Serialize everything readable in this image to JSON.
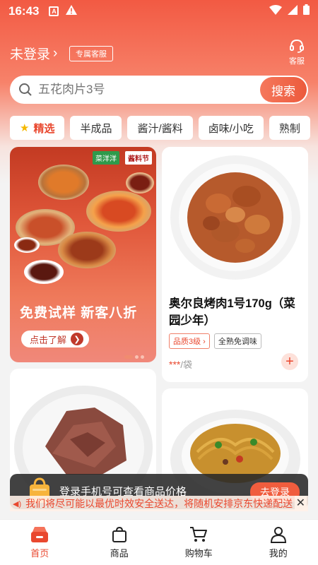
{
  "status_bar": {
    "time": "16:43",
    "notif_letter": "A"
  },
  "header": {
    "login_label": "未登录",
    "chevron": "›",
    "service_tag": "专属客服",
    "kefu_label": "客服"
  },
  "search": {
    "placeholder": "五花肉片3号",
    "button_label": "搜索"
  },
  "tabs": [
    {
      "label": "精选",
      "active": true
    },
    {
      "label": "半成品"
    },
    {
      "label": "酱汁/酱料"
    },
    {
      "label": "卤味/小吃"
    },
    {
      "label": "熟制"
    }
  ],
  "banner": {
    "brand_tag": "菜洋洋",
    "festival_tag": "酱料节",
    "headline": "免费试样 新客八折",
    "cta_label": "点击了解"
  },
  "products": [
    {
      "name": "奥尔良烤肉1号170g（菜园少年）",
      "badge_quality": "品质3级 ›",
      "badge_tag": "全熟免调味",
      "price": "***",
      "unit": "/袋",
      "add_label": "+"
    }
  ],
  "toast": {
    "message": "登录手机号可查看商品价格",
    "button_label": "去登录"
  },
  "notice": {
    "text": "我们将尽可能以最优时效安全送达，将随机安排京东快递配送"
  },
  "nav": {
    "home": "首页",
    "products": "商品",
    "cart": "购物车",
    "mine": "我的"
  },
  "colors": {
    "accent": "#e9482f",
    "hero_top": "#f25a43"
  }
}
